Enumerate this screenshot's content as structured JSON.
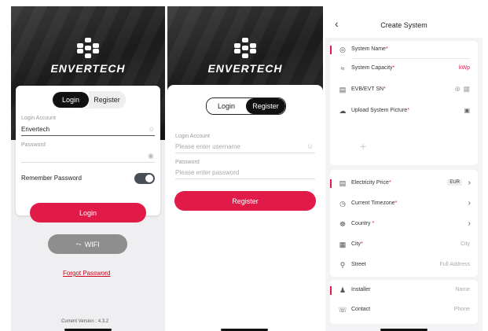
{
  "login": {
    "brand": "ENVERTECH",
    "tab_login": "Login",
    "tab_register": "Register",
    "account_label": "Login Account",
    "account_value": "Envertech",
    "password_label": "Password",
    "remember_label": "Remember Password",
    "remember_on": true,
    "login_button": "Login",
    "wifi_button": "WIFI",
    "forgot_link": "Forgot Password",
    "version": "Current Version : 4.3.2"
  },
  "register": {
    "brand": "ENVERTECH",
    "tab_login": "Login",
    "tab_register": "Register",
    "account_label": "Login Account",
    "account_placeholder": "Please enter username",
    "password_label": "Password",
    "password_placeholder": "Please enter password",
    "register_button": "Register"
  },
  "create_system": {
    "title": "Create System",
    "system_name": "System Name",
    "system_capacity": "System Capacity",
    "capacity_unit": "kWp",
    "evb_sn": "EVB/EVT SN",
    "upload_picture": "Upload System Picture",
    "electricity_price": "Electricity Price",
    "currency": "EUR",
    "timezone": "Current Timezone",
    "country": "Country",
    "city": "City",
    "city_placeholder": "City",
    "street": "Street",
    "street_placeholder": "Full Address",
    "installer": "Installer",
    "installer_placeholder": "Name",
    "contact": "Contact",
    "contact_placeholder": "Phone"
  },
  "colors": {
    "accent": "#e21a47",
    "dark": "#111111",
    "toggle": "#4a4f57"
  }
}
